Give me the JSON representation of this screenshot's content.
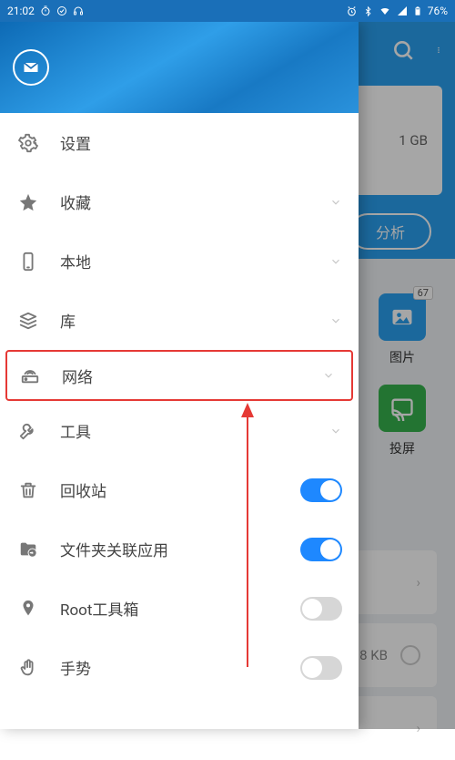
{
  "status": {
    "time": "21:02",
    "battery": "76%"
  },
  "drawer": {
    "items": [
      {
        "key": "settings",
        "label": "设置",
        "icon": "gear",
        "trailing": "none"
      },
      {
        "key": "fav",
        "label": "收藏",
        "icon": "star",
        "trailing": "chev"
      },
      {
        "key": "local",
        "label": "本地",
        "icon": "phone",
        "trailing": "chev"
      },
      {
        "key": "library",
        "label": "库",
        "icon": "stack",
        "trailing": "chev"
      },
      {
        "key": "network",
        "label": "网络",
        "icon": "router",
        "trailing": "chev",
        "highlight": true
      },
      {
        "key": "tools",
        "label": "工具",
        "icon": "wrench",
        "trailing": "chev"
      },
      {
        "key": "recycle",
        "label": "回收站",
        "icon": "trash",
        "trailing": "toggle",
        "on": true
      },
      {
        "key": "assoc",
        "label": "文件夹关联应用",
        "icon": "folder-link",
        "trailing": "toggle",
        "on": true
      },
      {
        "key": "root",
        "label": "Root工具箱",
        "icon": "pin",
        "trailing": "toggle",
        "on": false
      },
      {
        "key": "gesture",
        "label": "手势",
        "icon": "hand",
        "trailing": "toggle",
        "on": false
      }
    ]
  },
  "bg": {
    "storage_text": "1 GB",
    "analyze_label": "分析",
    "tiles": {
      "image_label": "图片",
      "image_badge": "67",
      "cast_label": "投屏"
    },
    "row1_text": "8 KB"
  }
}
